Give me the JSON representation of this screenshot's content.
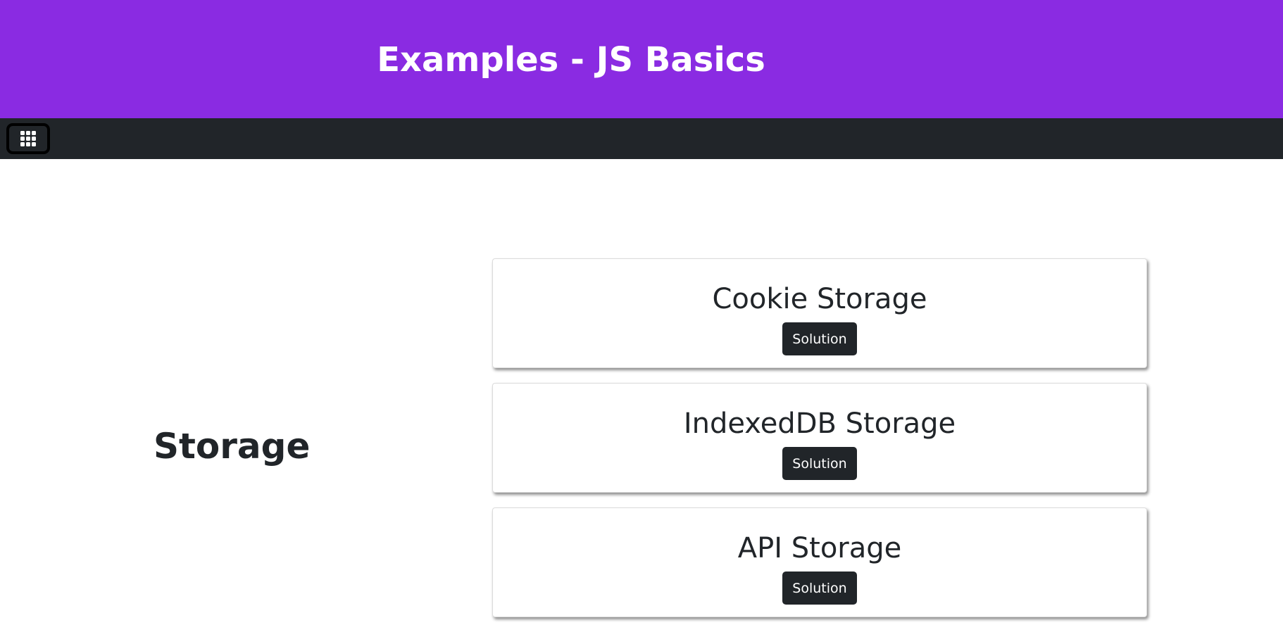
{
  "header": {
    "title": "Examples - JS Basics",
    "background_color": "#8a2be2"
  },
  "navbar": {
    "background_color": "#212529",
    "apps_button_icon": "grid-apps-icon"
  },
  "main": {
    "section_title": "Storage",
    "cards": [
      {
        "title": "Cookie Storage",
        "button_label": "Solution"
      },
      {
        "title": "IndexedDB Storage",
        "button_label": "Solution"
      },
      {
        "title": "API Storage",
        "button_label": "Solution"
      }
    ]
  }
}
